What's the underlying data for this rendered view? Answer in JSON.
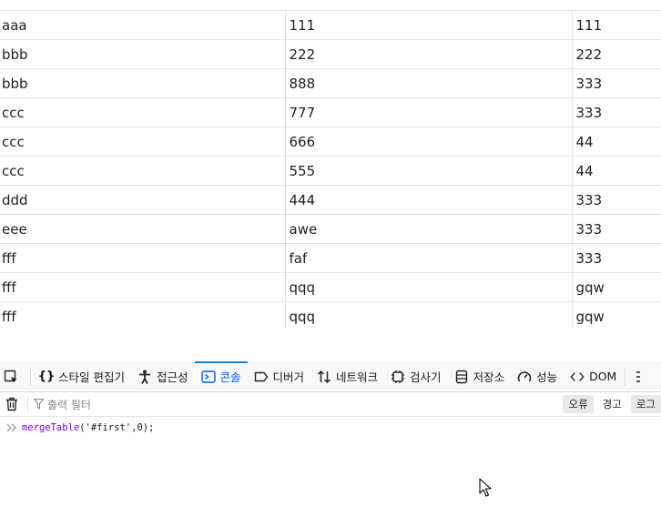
{
  "table": {
    "rows": [
      [
        "aaa",
        "111",
        "111"
      ],
      [
        "bbb",
        "222",
        "222"
      ],
      [
        "bbb",
        "888",
        "333"
      ],
      [
        "ccc",
        "777",
        "333"
      ],
      [
        "ccc",
        "666",
        "44"
      ],
      [
        "ccc",
        "555",
        "44"
      ],
      [
        "ddd",
        "444",
        "333"
      ],
      [
        "eee",
        "awe",
        "333"
      ],
      [
        "fff",
        "faf",
        "333"
      ],
      [
        "fff",
        "qqq",
        "gqw"
      ],
      [
        "fff",
        "qqq",
        "gqw"
      ]
    ]
  },
  "devtools": {
    "tabs": [
      {
        "label": "스타일 편집기",
        "icon": "braces-icon"
      },
      {
        "label": "접근성",
        "icon": "accessibility-icon"
      },
      {
        "label": "콘솔",
        "icon": "console-icon",
        "active": true
      },
      {
        "label": "디버거",
        "icon": "debugger-icon"
      },
      {
        "label": "네트워크",
        "icon": "network-icon"
      },
      {
        "label": "검사기",
        "icon": "inspector-icon"
      },
      {
        "label": "저장소",
        "icon": "storage-icon"
      },
      {
        "label": "성능",
        "icon": "performance-icon"
      },
      {
        "label": "DOM",
        "icon": "dom-icon"
      }
    ],
    "filter_placeholder": "출력 필터",
    "levels": {
      "error": "오류",
      "warning": "경고",
      "log": "로그"
    },
    "console_input": {
      "fn": "mergeTable",
      "open": "(",
      "arg1": "'#first'",
      "comma": ",",
      "arg2": "0",
      "close": ");"
    },
    "accent_color": "#0a84ff"
  }
}
